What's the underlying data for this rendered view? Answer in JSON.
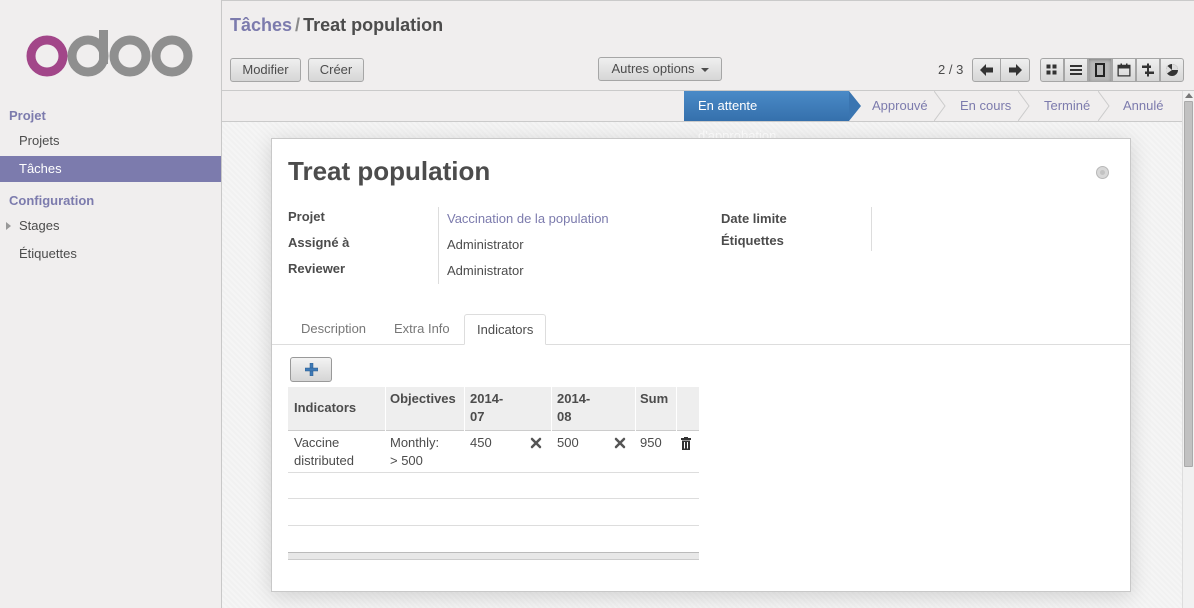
{
  "sidebar": {
    "logo_text": "odoo",
    "sections": [
      {
        "title": "Projet",
        "items": [
          {
            "label": "Projets"
          },
          {
            "label": "Tâches",
            "active": true
          }
        ]
      },
      {
        "title": "Configuration",
        "items": [
          {
            "label": "Stages",
            "expandable": true
          },
          {
            "label": "Étiquettes"
          }
        ]
      }
    ]
  },
  "header": {
    "breadcrumb_parent": "Tâches",
    "breadcrumb_sep": "/",
    "breadcrumb_current": "Treat population",
    "edit_label": "Modifier",
    "create_label": "Créer",
    "more_label": "Autres options",
    "pager_text": "2 / 3",
    "views": [
      "kanban-icon",
      "list-icon",
      "form-icon",
      "calendar-icon",
      "gantt-icon",
      "graph-icon"
    ],
    "active_view": "form-icon"
  },
  "stages": {
    "items": [
      "En attente d'approbation",
      "Approuvé",
      "En cours",
      "Terminé",
      "Annulé"
    ],
    "active": "En attente d'approbation"
  },
  "record": {
    "title": "Treat population",
    "fields_left": [
      {
        "label": "Projet",
        "value": "Vaccination de la population",
        "is_link": true
      },
      {
        "label": "Assigné à",
        "value": "Administrator"
      },
      {
        "label": "Reviewer",
        "value": "Administrator"
      }
    ],
    "fields_right": [
      {
        "label": "Date limite",
        "value": ""
      },
      {
        "label": "Étiquettes",
        "value": ""
      }
    ]
  },
  "tabs": [
    "Description",
    "Extra Info",
    "Indicators"
  ],
  "active_tab": "Indicators",
  "indicators_table": {
    "columns": [
      "Indicators",
      "Objectives",
      "2014-07",
      "2014-08",
      "Sum"
    ],
    "col_line1": [
      "",
      "",
      "2014-",
      "2014-",
      ""
    ],
    "col_line2": [
      "",
      "",
      "07",
      "08",
      ""
    ],
    "rows": [
      {
        "indicator_l1": "Vaccine",
        "indicator_l2": "distributed",
        "objective_l1": "Monthly:",
        "objective_l2": "> 500",
        "m1": "450",
        "m2": "500",
        "sum": "950"
      }
    ]
  },
  "colors": {
    "accent": "#7c7bad",
    "stage_active": "#3e7ab8"
  }
}
